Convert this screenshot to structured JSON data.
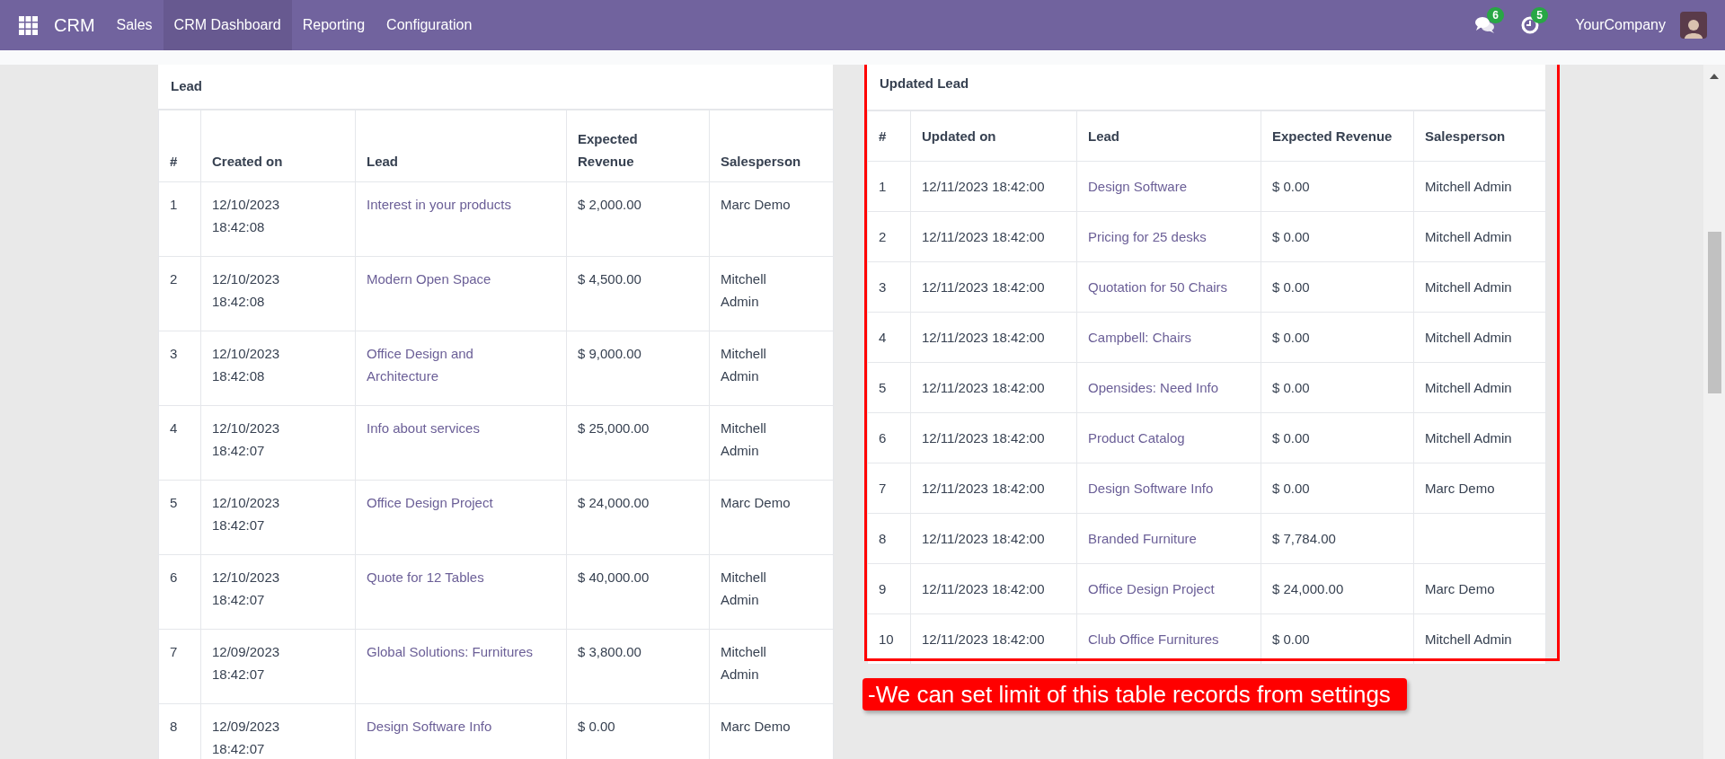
{
  "navbar": {
    "app": "CRM",
    "menu": [
      {
        "label": "Sales",
        "selected": false
      },
      {
        "label": "CRM Dashboard",
        "selected": true
      },
      {
        "label": "Reporting",
        "selected": false
      },
      {
        "label": "Configuration",
        "selected": false
      }
    ],
    "messages_count": "6",
    "activities_count": "5",
    "company": "YourCompany"
  },
  "lead_table": {
    "title": "Lead",
    "columns": [
      "#",
      "Created on",
      "Lead",
      "Expected Revenue",
      "Salesperson"
    ],
    "rows": [
      [
        "1",
        "12/10/2023 18:42:08",
        "Interest in your products",
        "$ 2,000.00",
        "Marc Demo"
      ],
      [
        "2",
        "12/10/2023 18:42:08",
        "Modern Open Space",
        "$ 4,500.00",
        "Mitchell Admin"
      ],
      [
        "3",
        "12/10/2023 18:42:08",
        "Office Design and Architecture",
        "$ 9,000.00",
        "Mitchell Admin"
      ],
      [
        "4",
        "12/10/2023 18:42:07",
        "Info about services",
        "$ 25,000.00",
        "Mitchell Admin"
      ],
      [
        "5",
        "12/10/2023 18:42:07",
        "Office Design Project",
        "$ 24,000.00",
        "Marc Demo"
      ],
      [
        "6",
        "12/10/2023 18:42:07",
        "Quote for 12 Tables",
        "$ 40,000.00",
        "Mitchell Admin"
      ],
      [
        "7",
        "12/09/2023 18:42:07",
        "Global Solutions: Furnitures",
        "$ 3,800.00",
        "Mitchell Admin"
      ],
      [
        "8",
        "12/09/2023 18:42:07",
        "Design Software Info",
        "$ 0.00",
        "Marc Demo"
      ]
    ]
  },
  "updated_lead_table": {
    "title": "Updated Lead",
    "columns": [
      "#",
      "Updated on",
      "Lead",
      "Expected Revenue",
      "Salesperson"
    ],
    "rows": [
      [
        "1",
        "12/11/2023 18:42:00",
        "Design Software",
        "$ 0.00",
        "Mitchell Admin"
      ],
      [
        "2",
        "12/11/2023 18:42:00",
        "Pricing for 25 desks",
        "$ 0.00",
        "Mitchell Admin"
      ],
      [
        "3",
        "12/11/2023 18:42:00",
        "Quotation for 50 Chairs",
        "$ 0.00",
        "Mitchell Admin"
      ],
      [
        "4",
        "12/11/2023 18:42:00",
        "Campbell: Chairs",
        "$ 0.00",
        "Mitchell Admin"
      ],
      [
        "5",
        "12/11/2023 18:42:00",
        "Opensides: Need Info",
        "$ 0.00",
        "Mitchell Admin"
      ],
      [
        "6",
        "12/11/2023 18:42:00",
        "Product Catalog",
        "$ 0.00",
        "Mitchell Admin"
      ],
      [
        "7",
        "12/11/2023 18:42:00",
        "Design Software Info",
        "$ 0.00",
        "Marc Demo"
      ],
      [
        "8",
        "12/11/2023 18:42:00",
        "Branded Furniture",
        "$ 7,784.00"
      ],
      [
        "9",
        "12/11/2023 18:42:00",
        "Office Design Project",
        "$ 24,000.00",
        "Marc Demo"
      ],
      [
        "10",
        "12/11/2023 18:42:00",
        "Club Office Furnitures",
        "$ 0.00",
        "Mitchell Admin"
      ]
    ]
  },
  "annotation": {
    "text": "-We can set limit of this table records from settings"
  }
}
